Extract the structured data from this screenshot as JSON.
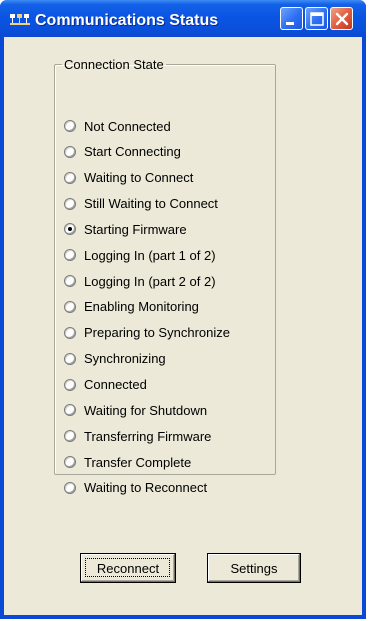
{
  "window": {
    "title": "Communications Status",
    "icon": "app-network-icon"
  },
  "title_buttons": [
    "minimize-icon",
    "maximize-icon",
    "close-icon"
  ],
  "connection_state": {
    "legend": "Connection State",
    "selected": "Starting Firmware",
    "options": [
      "Not Connected",
      "Start Connecting",
      "Waiting to Connect",
      "Still Waiting to Connect",
      "Starting Firmware",
      "Logging In (part 1 of 2)",
      "Logging In (part 2 of 2)",
      "Enabling Monitoring",
      "Preparing to Synchronize",
      "Synchronizing",
      "Connected",
      "Waiting for Shutdown",
      "Transferring Firmware",
      "Transfer Complete",
      "Waiting to Reconnect"
    ]
  },
  "buttons": {
    "reconnect": "Reconnect",
    "settings": "Settings"
  }
}
